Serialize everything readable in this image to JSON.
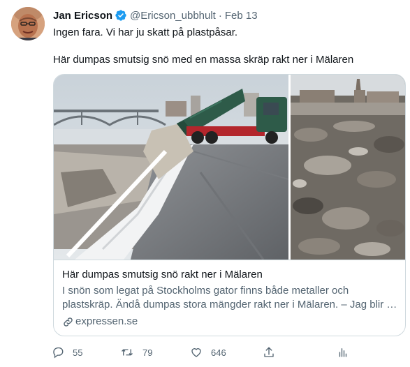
{
  "tweet": {
    "author_name": "Jan Ericson",
    "handle": "@Ericson_ubbhult",
    "separator": "·",
    "date": "Feb 13",
    "verified": true,
    "text_line1": "Ingen fara. Vi har ju skatt på plastpåsar.",
    "text_line2": "Här dumpas smutsig snö med en massa skräp rakt ner i Mälaren"
  },
  "card": {
    "title": "Här dumpas smutsig snö rakt ner i Mälaren",
    "description_line1": "I snön som legat på Stockholms gator finns både metaller och",
    "description_line2": "plastskräp. Ändå dumpas stora mängder rakt ner i Mälaren. – Jag blir …",
    "domain": "expressen.se",
    "images": [
      "truck-dumping-snow-photo",
      "debris-in-lake-photo"
    ]
  },
  "actions": {
    "replies": "55",
    "retweets": "79",
    "likes": "646"
  },
  "icons": {
    "verified": "verified-badge-icon",
    "reply": "reply-icon",
    "retweet": "retweet-icon",
    "like": "heart-icon",
    "share": "share-icon",
    "analytics": "analytics-icon",
    "link": "link-icon"
  },
  "colors": {
    "verified_blue": "#1d9bf0",
    "secondary_text": "#536471",
    "border": "#cfd9de",
    "truck_green": "#2e5b49",
    "truck_red": "#b3262c"
  }
}
